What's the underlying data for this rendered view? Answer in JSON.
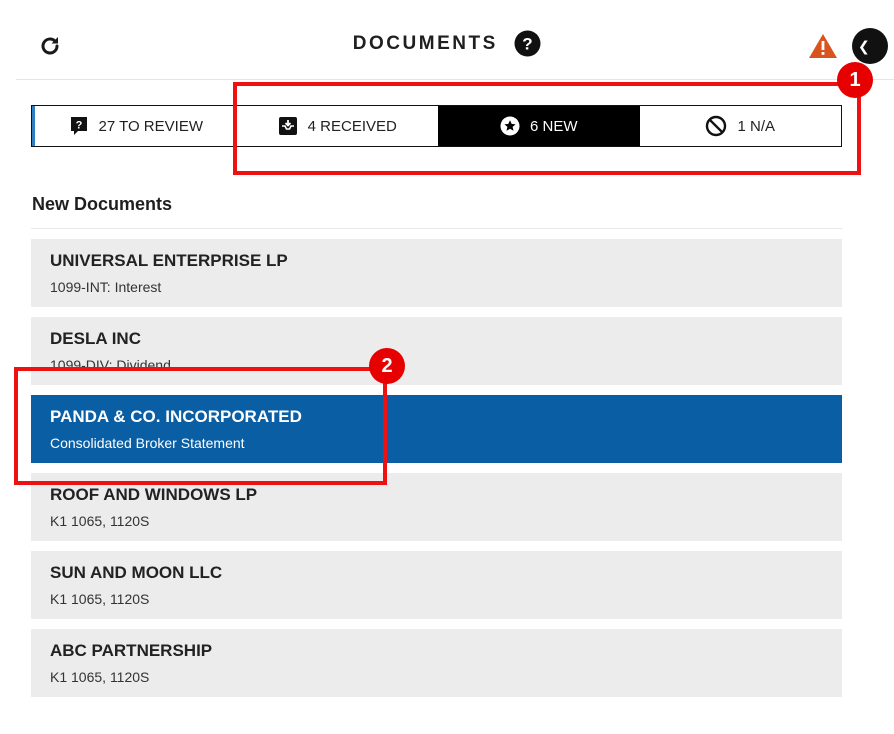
{
  "header": {
    "title": "DOCUMENTS",
    "refresh_icon": "refresh-icon",
    "help_icon": "help-circle-icon",
    "alert_icon": "warning-triangle-icon",
    "alert_color": "#d9531e"
  },
  "tabs": [
    {
      "label": "27 TO REVIEW",
      "icon": "question-chat-icon",
      "active": false
    },
    {
      "label": "4 RECEIVED",
      "icon": "inbox-download-icon",
      "active": false
    },
    {
      "label": "6 NEW",
      "icon": "star-circle-icon",
      "active": true
    },
    {
      "label": "1 N/A",
      "icon": "prohibited-icon",
      "active": false
    }
  ],
  "section": {
    "title": "New Documents"
  },
  "documents": [
    {
      "name": "UNIVERSAL ENTERPRISE LP",
      "type": "1099-INT: Interest",
      "selected": false
    },
    {
      "name": "DESLA INC",
      "type": "1099-DIV: Dividend",
      "selected": false
    },
    {
      "name": "PANDA & CO. INCORPORATED",
      "type": "Consolidated Broker Statement",
      "selected": true
    },
    {
      "name": "ROOF AND WINDOWS LP",
      "type": "K1 1065, 1120S",
      "selected": false
    },
    {
      "name": "SUN AND MOON LLC",
      "type": "K1 1065, 1120S",
      "selected": false
    },
    {
      "name": "ABC PARTNERSHIP",
      "type": "K1 1065, 1120S",
      "selected": false
    }
  ],
  "annotations": [
    {
      "number": "1"
    },
    {
      "number": "2"
    }
  ],
  "colors": {
    "selected_row": "#0a5ea4",
    "row_bg": "#ececec",
    "active_tab": "#000000",
    "annotation_red": "#e60000"
  }
}
